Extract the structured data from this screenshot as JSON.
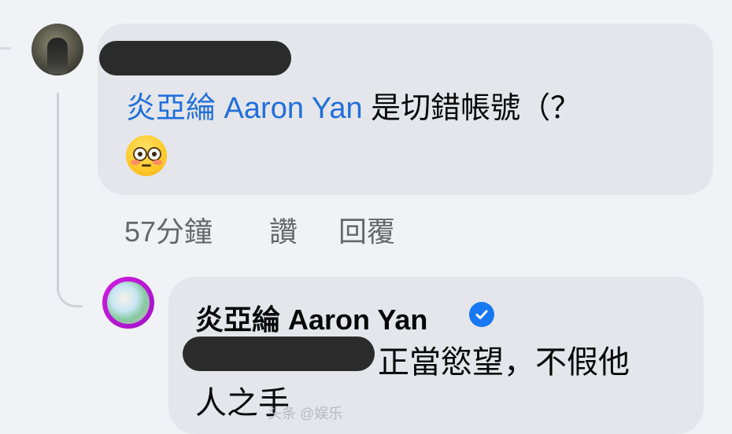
{
  "comment": {
    "mention": "炎亞綸 Aaron Yan",
    "text": " 是切錯帳號（？",
    "emoji": "flushed-face-emoji"
  },
  "actions": {
    "time": "57分鐘",
    "like": "讚",
    "reply": "回覆"
  },
  "reply": {
    "author": "炎亞綸 Aaron Yan",
    "text_line1": "正當慾望，不假他",
    "text_line2": "人之手",
    "verified_icon": "verified-check-icon"
  },
  "watermark": "头条 @娱乐"
}
